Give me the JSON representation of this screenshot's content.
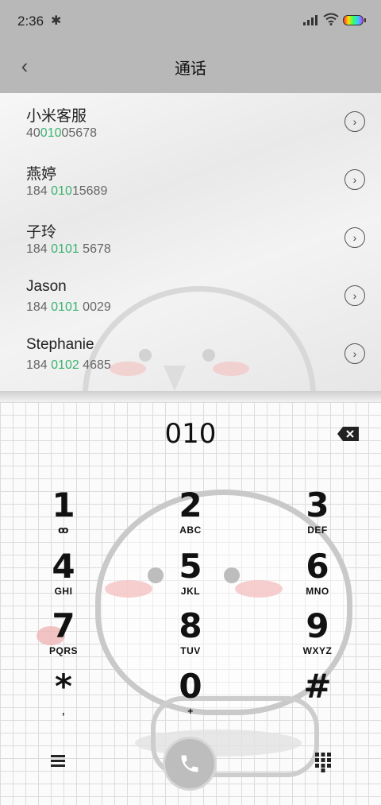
{
  "status_bar": {
    "time": "2:36",
    "bluetooth_icon": "bluetooth-icon"
  },
  "header": {
    "title": "通话",
    "back_icon": "chevron-left-icon"
  },
  "contacts": [
    {
      "name": "小米客服",
      "num_pre": "40",
      "num_match": "010",
      "num_post": "05678"
    },
    {
      "name": "燕婷",
      "num_pre": "184 ",
      "num_match": "010",
      "num_post": "15689"
    },
    {
      "name": "子玲",
      "num_pre": "184 ",
      "num_match": "0101",
      "num_post": " 5678"
    },
    {
      "name": "Jason",
      "num_pre": "184 ",
      "num_match": "0101",
      "num_post": " 0029"
    },
    {
      "name": "Stephanie",
      "num_pre": "184 ",
      "num_match": "0102",
      "num_post": " 4685"
    }
  ],
  "dialpad": {
    "entered": "010",
    "keys": [
      {
        "digit": "1",
        "letters": "ꝏ"
      },
      {
        "digit": "2",
        "letters": "ABC"
      },
      {
        "digit": "3",
        "letters": "DEF"
      },
      {
        "digit": "4",
        "letters": "GHI"
      },
      {
        "digit": "5",
        "letters": "JKL"
      },
      {
        "digit": "6",
        "letters": "MNO"
      },
      {
        "digit": "7",
        "letters": "PQRS"
      },
      {
        "digit": "8",
        "letters": "TUV"
      },
      {
        "digit": "9",
        "letters": "WXYZ"
      },
      {
        "digit": "*",
        "letters": ","
      },
      {
        "digit": "0",
        "letters": "+"
      },
      {
        "digit": "#",
        "letters": ""
      }
    ]
  },
  "icons": {
    "delete": "backspace-icon",
    "menu": "menu-icon",
    "call": "phone-icon",
    "keypad": "keypad-icon"
  },
  "colors": {
    "match": "#3cb371",
    "header_bg": "#b8b8b8"
  }
}
